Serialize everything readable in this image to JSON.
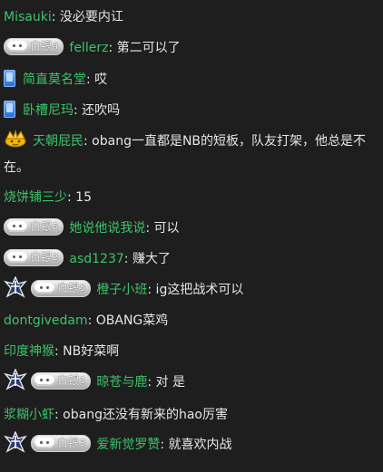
{
  "accent_name_color": "#3ec36a",
  "badge_text": "白银",
  "messages": [
    {
      "name": "Misauki",
      "colon": ":",
      "text": " 没必要内讧"
    },
    {
      "badge_level": "4",
      "name": "fellerz",
      "colon": ":",
      "text": " 第二可以了"
    },
    {
      "icon": "phone-icon",
      "name": "简直莫名堂",
      "colon": ":",
      "text": " 哎"
    },
    {
      "icon": "phone-icon",
      "name": "卧槽尼玛",
      "colon": ":",
      "text": " 还吹吗"
    },
    {
      "icon": "crown-icon",
      "name": "天朝屁民",
      "colon": ":",
      "text": " obang一直都是NB的短板，队友打架，他总是不在。"
    },
    {
      "name": "烧饼铺三少",
      "colon": ":",
      "text": " 15"
    },
    {
      "badge_level": "5",
      "name": "她说他说我说",
      "colon": ":",
      "text": " 可以"
    },
    {
      "badge_level": "2",
      "name": "asd1237",
      "colon": ":",
      "text": " 赚大了"
    },
    {
      "icon": "team-logo-icon",
      "badge_level": "5",
      "name": "橙子小班",
      "colon": ":",
      "text": " ig这把战术可以"
    },
    {
      "name": "dontgivedam",
      "colon": ":",
      "text": " OBANG菜鸡"
    },
    {
      "name": "印度神猴",
      "colon": ":",
      "text": " NB好菜啊"
    },
    {
      "icon": "team-logo-icon",
      "badge_level": "1",
      "name": "晾苍与鹿",
      "colon": ":",
      "text": " 对 是"
    },
    {
      "name": "浆糊小虾",
      "colon": ":",
      "text": " obang还没有新来的hao厉害"
    },
    {
      "icon": "team-logo-icon",
      "badge_level": "3",
      "name": "爱新觉罗赞",
      "colon": ":",
      "text": " 就喜欢内战"
    }
  ]
}
